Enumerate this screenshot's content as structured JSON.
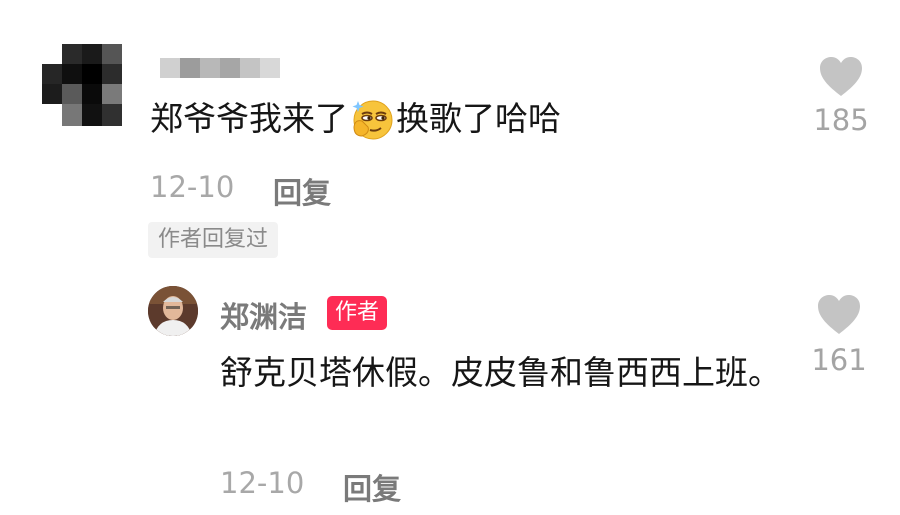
{
  "comment": {
    "text_before": "郑爷爷我来了",
    "emoji_icon": "smirk-emoji",
    "text_after": "换歌了哈哈",
    "date": "12-10",
    "reply_label": "回复",
    "author_replied_tag": "作者回复过",
    "like_count": "185"
  },
  "reply": {
    "author_name": "郑渊洁",
    "author_badge": "作者",
    "text": "舒克贝塔休假。皮皮鲁和鲁西西上班。",
    "date": "12-10",
    "reply_label": "回复",
    "like_count": "161"
  },
  "colors": {
    "badge": "#fe2c55",
    "heart": "#c4c4c4"
  }
}
